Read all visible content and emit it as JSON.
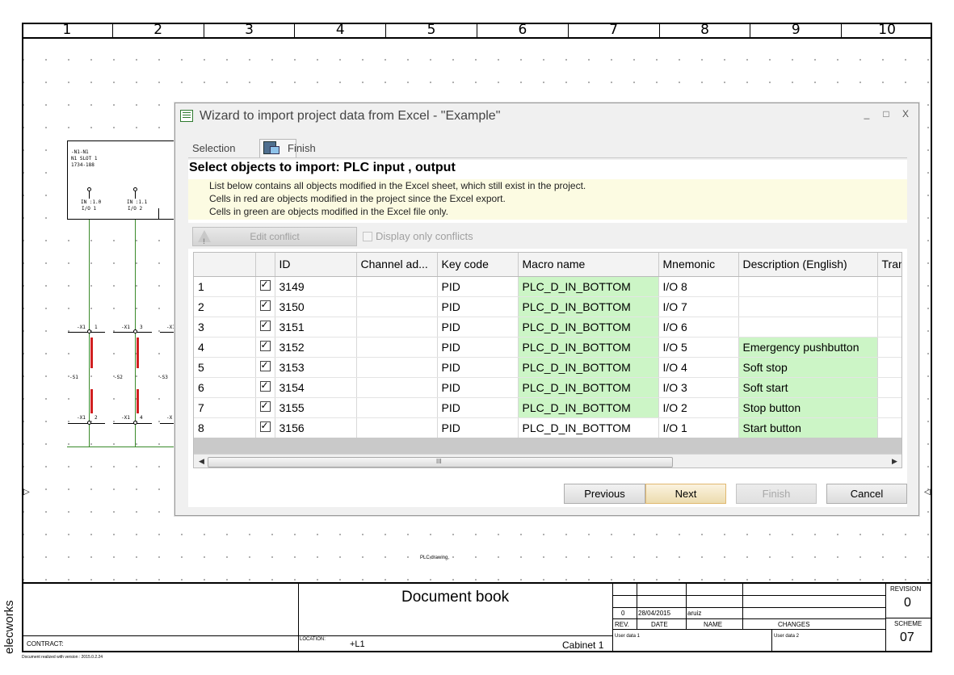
{
  "sheet": {
    "columns": [
      "1",
      "2",
      "3",
      "4",
      "5",
      "6",
      "7",
      "8",
      "9",
      "10"
    ],
    "plc_labels": {
      "line1": "-N1-N1",
      "line2": "N1 SLOT 1",
      "line3": "1734-188",
      "io1_a": "IN :1.0",
      "io1_b": "I/O 1",
      "io2_a": "IN :1.1",
      "io2_b": "I/O 2"
    },
    "terminal_labels": [
      "-X1",
      "1",
      "-X1",
      "3",
      "-X1",
      "-S1",
      "-S2",
      "-S3",
      "-X1",
      "2",
      "-X1",
      "4",
      "-X"
    ],
    "drawing_caption": "PLC,drawing,"
  },
  "title_block": {
    "project_title": "Document book",
    "revision_label": "REVISION",
    "revision_value": "0",
    "scheme_label": "SCHEME",
    "scheme_value": "07",
    "rev_header": "REV.",
    "date_header": "DATE",
    "name_header": "NAME",
    "changes_header": "CHANGES",
    "rev_row_rev": "0",
    "rev_row_date": "28/04/2015",
    "rev_row_name": "aruiz",
    "contract_label": "CONTRACT:",
    "location_label": "LOCATION:",
    "location_value": "+L1",
    "cabinet_value": "Cabinet 1",
    "user_data_1": "User data 1",
    "user_data_2": "User data 2",
    "brand": "elecworks",
    "version_note": "Document realized with version : 2015.0.2.24"
  },
  "dialog": {
    "title": "Wizard to import project data from Excel - \"Example\"",
    "window_controls": [
      "_",
      "□",
      "X"
    ],
    "steps": [
      "Selection",
      "Finish"
    ],
    "heading": "Select objects to import: PLC input , output",
    "info_lines": [
      "List below contains all objects modified in the Excel sheet, which still exist in the project.",
      "Cells in red are objects modified in the project since the Excel export.",
      "Cells in green are objects modified in the Excel file only."
    ],
    "edit_conflict_label": "Edit conflict",
    "display_conflicts_label": "Display only conflicts",
    "columns": [
      "",
      "",
      "ID",
      "Channel ad...",
      "Key code",
      "Macro name",
      "Mnemonic",
      "Description (English)",
      "Tran"
    ],
    "rows": [
      {
        "n": "1",
        "id": "3149",
        "channel": "",
        "key": "PID",
        "macro": "PLC_D_IN_BOTTOM",
        "mnemonic": "I/O 8",
        "desc": ""
      },
      {
        "n": "2",
        "id": "3150",
        "channel": "",
        "key": "PID",
        "macro": "PLC_D_IN_BOTTOM",
        "mnemonic": "I/O 7",
        "desc": ""
      },
      {
        "n": "3",
        "id": "3151",
        "channel": "",
        "key": "PID",
        "macro": "PLC_D_IN_BOTTOM",
        "mnemonic": "I/O 6",
        "desc": ""
      },
      {
        "n": "4",
        "id": "3152",
        "channel": "",
        "key": "PID",
        "macro": "PLC_D_IN_BOTTOM",
        "mnemonic": "I/O 5",
        "desc": "Emergency pushbutton"
      },
      {
        "n": "5",
        "id": "3153",
        "channel": "",
        "key": "PID",
        "macro": "PLC_D_IN_BOTTOM",
        "mnemonic": "I/O 4",
        "desc": "Soft stop"
      },
      {
        "n": "6",
        "id": "3154",
        "channel": "",
        "key": "PID",
        "macro": "PLC_D_IN_BOTTOM",
        "mnemonic": "I/O 3",
        "desc": "Soft start"
      },
      {
        "n": "7",
        "id": "3155",
        "channel": "",
        "key": "PID",
        "macro": "PLC_D_IN_BOTTOM",
        "mnemonic": "I/O 2",
        "desc": "Stop button"
      },
      {
        "n": "8",
        "id": "3156",
        "channel": "",
        "key": "PID",
        "macro": "PLC_D_IN_BOTTOM",
        "mnemonic": "I/O 1",
        "desc": "Start button"
      }
    ],
    "scroll_grip": "III",
    "buttons": {
      "previous": "Previous",
      "next": "Next",
      "finish": "Finish",
      "cancel": "Cancel"
    },
    "colors": {
      "modified_in_excel": "#ccf5c6",
      "info_background": "#fcfbe2"
    }
  }
}
